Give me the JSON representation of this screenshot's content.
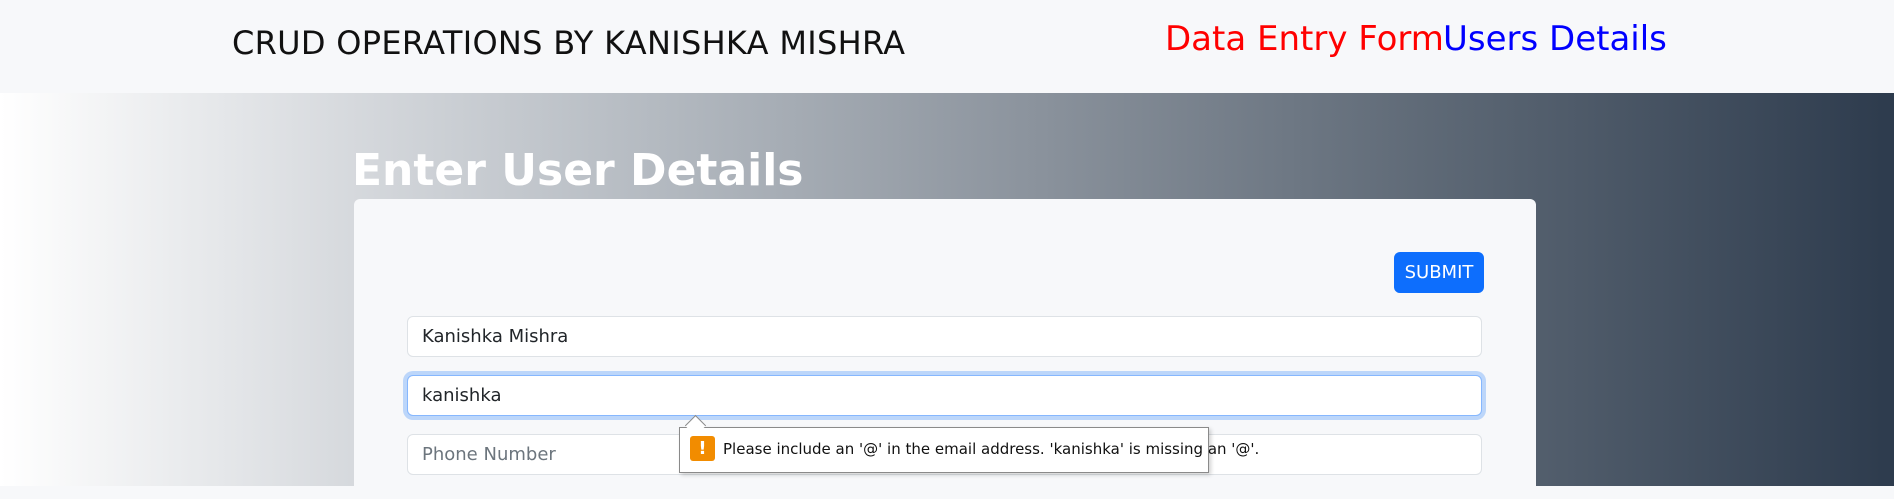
{
  "navbar": {
    "brand": "CRUD OPERATIONS BY KANISHKA MISHRA",
    "links": [
      {
        "label": "Data Entry Form",
        "color": "#ff0000"
      },
      {
        "label": "Users Details",
        "color": "#0000ff"
      }
    ]
  },
  "form": {
    "heading": "Enter User Details",
    "submit_label": "SUBMIT",
    "fields": {
      "name": {
        "value": "Kanishka Mishra",
        "placeholder": ""
      },
      "email": {
        "value": "kanishka",
        "placeholder": ""
      },
      "phone": {
        "value": "",
        "placeholder": "Phone Number"
      }
    }
  },
  "validation": {
    "icon": "warning-icon",
    "icon_glyph": "!",
    "icon_color": "#f28c00",
    "message": "Please include an '@' in the email address. 'kanishka' is missing an '@'."
  },
  "colors": {
    "accent": "#0d6efd"
  }
}
